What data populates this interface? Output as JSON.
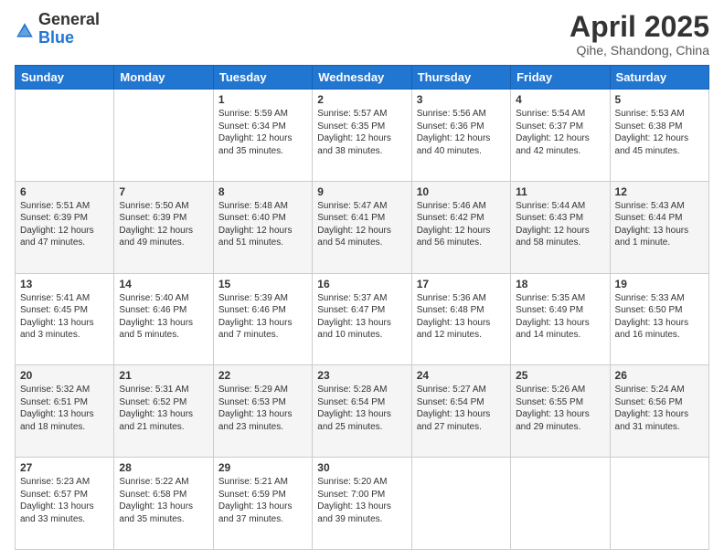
{
  "header": {
    "logo_general": "General",
    "logo_blue": "Blue",
    "title": "April 2025",
    "location": "Qihe, Shandong, China"
  },
  "days_of_week": [
    "Sunday",
    "Monday",
    "Tuesday",
    "Wednesday",
    "Thursday",
    "Friday",
    "Saturday"
  ],
  "weeks": [
    [
      {
        "day": "",
        "sunrise": "",
        "sunset": "",
        "daylight": ""
      },
      {
        "day": "",
        "sunrise": "",
        "sunset": "",
        "daylight": ""
      },
      {
        "day": "1",
        "sunrise": "Sunrise: 5:59 AM",
        "sunset": "Sunset: 6:34 PM",
        "daylight": "Daylight: 12 hours and 35 minutes."
      },
      {
        "day": "2",
        "sunrise": "Sunrise: 5:57 AM",
        "sunset": "Sunset: 6:35 PM",
        "daylight": "Daylight: 12 hours and 38 minutes."
      },
      {
        "day": "3",
        "sunrise": "Sunrise: 5:56 AM",
        "sunset": "Sunset: 6:36 PM",
        "daylight": "Daylight: 12 hours and 40 minutes."
      },
      {
        "day": "4",
        "sunrise": "Sunrise: 5:54 AM",
        "sunset": "Sunset: 6:37 PM",
        "daylight": "Daylight: 12 hours and 42 minutes."
      },
      {
        "day": "5",
        "sunrise": "Sunrise: 5:53 AM",
        "sunset": "Sunset: 6:38 PM",
        "daylight": "Daylight: 12 hours and 45 minutes."
      }
    ],
    [
      {
        "day": "6",
        "sunrise": "Sunrise: 5:51 AM",
        "sunset": "Sunset: 6:39 PM",
        "daylight": "Daylight: 12 hours and 47 minutes."
      },
      {
        "day": "7",
        "sunrise": "Sunrise: 5:50 AM",
        "sunset": "Sunset: 6:39 PM",
        "daylight": "Daylight: 12 hours and 49 minutes."
      },
      {
        "day": "8",
        "sunrise": "Sunrise: 5:48 AM",
        "sunset": "Sunset: 6:40 PM",
        "daylight": "Daylight: 12 hours and 51 minutes."
      },
      {
        "day": "9",
        "sunrise": "Sunrise: 5:47 AM",
        "sunset": "Sunset: 6:41 PM",
        "daylight": "Daylight: 12 hours and 54 minutes."
      },
      {
        "day": "10",
        "sunrise": "Sunrise: 5:46 AM",
        "sunset": "Sunset: 6:42 PM",
        "daylight": "Daylight: 12 hours and 56 minutes."
      },
      {
        "day": "11",
        "sunrise": "Sunrise: 5:44 AM",
        "sunset": "Sunset: 6:43 PM",
        "daylight": "Daylight: 12 hours and 58 minutes."
      },
      {
        "day": "12",
        "sunrise": "Sunrise: 5:43 AM",
        "sunset": "Sunset: 6:44 PM",
        "daylight": "Daylight: 13 hours and 1 minute."
      }
    ],
    [
      {
        "day": "13",
        "sunrise": "Sunrise: 5:41 AM",
        "sunset": "Sunset: 6:45 PM",
        "daylight": "Daylight: 13 hours and 3 minutes."
      },
      {
        "day": "14",
        "sunrise": "Sunrise: 5:40 AM",
        "sunset": "Sunset: 6:46 PM",
        "daylight": "Daylight: 13 hours and 5 minutes."
      },
      {
        "day": "15",
        "sunrise": "Sunrise: 5:39 AM",
        "sunset": "Sunset: 6:46 PM",
        "daylight": "Daylight: 13 hours and 7 minutes."
      },
      {
        "day": "16",
        "sunrise": "Sunrise: 5:37 AM",
        "sunset": "Sunset: 6:47 PM",
        "daylight": "Daylight: 13 hours and 10 minutes."
      },
      {
        "day": "17",
        "sunrise": "Sunrise: 5:36 AM",
        "sunset": "Sunset: 6:48 PM",
        "daylight": "Daylight: 13 hours and 12 minutes."
      },
      {
        "day": "18",
        "sunrise": "Sunrise: 5:35 AM",
        "sunset": "Sunset: 6:49 PM",
        "daylight": "Daylight: 13 hours and 14 minutes."
      },
      {
        "day": "19",
        "sunrise": "Sunrise: 5:33 AM",
        "sunset": "Sunset: 6:50 PM",
        "daylight": "Daylight: 13 hours and 16 minutes."
      }
    ],
    [
      {
        "day": "20",
        "sunrise": "Sunrise: 5:32 AM",
        "sunset": "Sunset: 6:51 PM",
        "daylight": "Daylight: 13 hours and 18 minutes."
      },
      {
        "day": "21",
        "sunrise": "Sunrise: 5:31 AM",
        "sunset": "Sunset: 6:52 PM",
        "daylight": "Daylight: 13 hours and 21 minutes."
      },
      {
        "day": "22",
        "sunrise": "Sunrise: 5:29 AM",
        "sunset": "Sunset: 6:53 PM",
        "daylight": "Daylight: 13 hours and 23 minutes."
      },
      {
        "day": "23",
        "sunrise": "Sunrise: 5:28 AM",
        "sunset": "Sunset: 6:54 PM",
        "daylight": "Daylight: 13 hours and 25 minutes."
      },
      {
        "day": "24",
        "sunrise": "Sunrise: 5:27 AM",
        "sunset": "Sunset: 6:54 PM",
        "daylight": "Daylight: 13 hours and 27 minutes."
      },
      {
        "day": "25",
        "sunrise": "Sunrise: 5:26 AM",
        "sunset": "Sunset: 6:55 PM",
        "daylight": "Daylight: 13 hours and 29 minutes."
      },
      {
        "day": "26",
        "sunrise": "Sunrise: 5:24 AM",
        "sunset": "Sunset: 6:56 PM",
        "daylight": "Daylight: 13 hours and 31 minutes."
      }
    ],
    [
      {
        "day": "27",
        "sunrise": "Sunrise: 5:23 AM",
        "sunset": "Sunset: 6:57 PM",
        "daylight": "Daylight: 13 hours and 33 minutes."
      },
      {
        "day": "28",
        "sunrise": "Sunrise: 5:22 AM",
        "sunset": "Sunset: 6:58 PM",
        "daylight": "Daylight: 13 hours and 35 minutes."
      },
      {
        "day": "29",
        "sunrise": "Sunrise: 5:21 AM",
        "sunset": "Sunset: 6:59 PM",
        "daylight": "Daylight: 13 hours and 37 minutes."
      },
      {
        "day": "30",
        "sunrise": "Sunrise: 5:20 AM",
        "sunset": "Sunset: 7:00 PM",
        "daylight": "Daylight: 13 hours and 39 minutes."
      },
      {
        "day": "",
        "sunrise": "",
        "sunset": "",
        "daylight": ""
      },
      {
        "day": "",
        "sunrise": "",
        "sunset": "",
        "daylight": ""
      },
      {
        "day": "",
        "sunrise": "",
        "sunset": "",
        "daylight": ""
      }
    ]
  ]
}
